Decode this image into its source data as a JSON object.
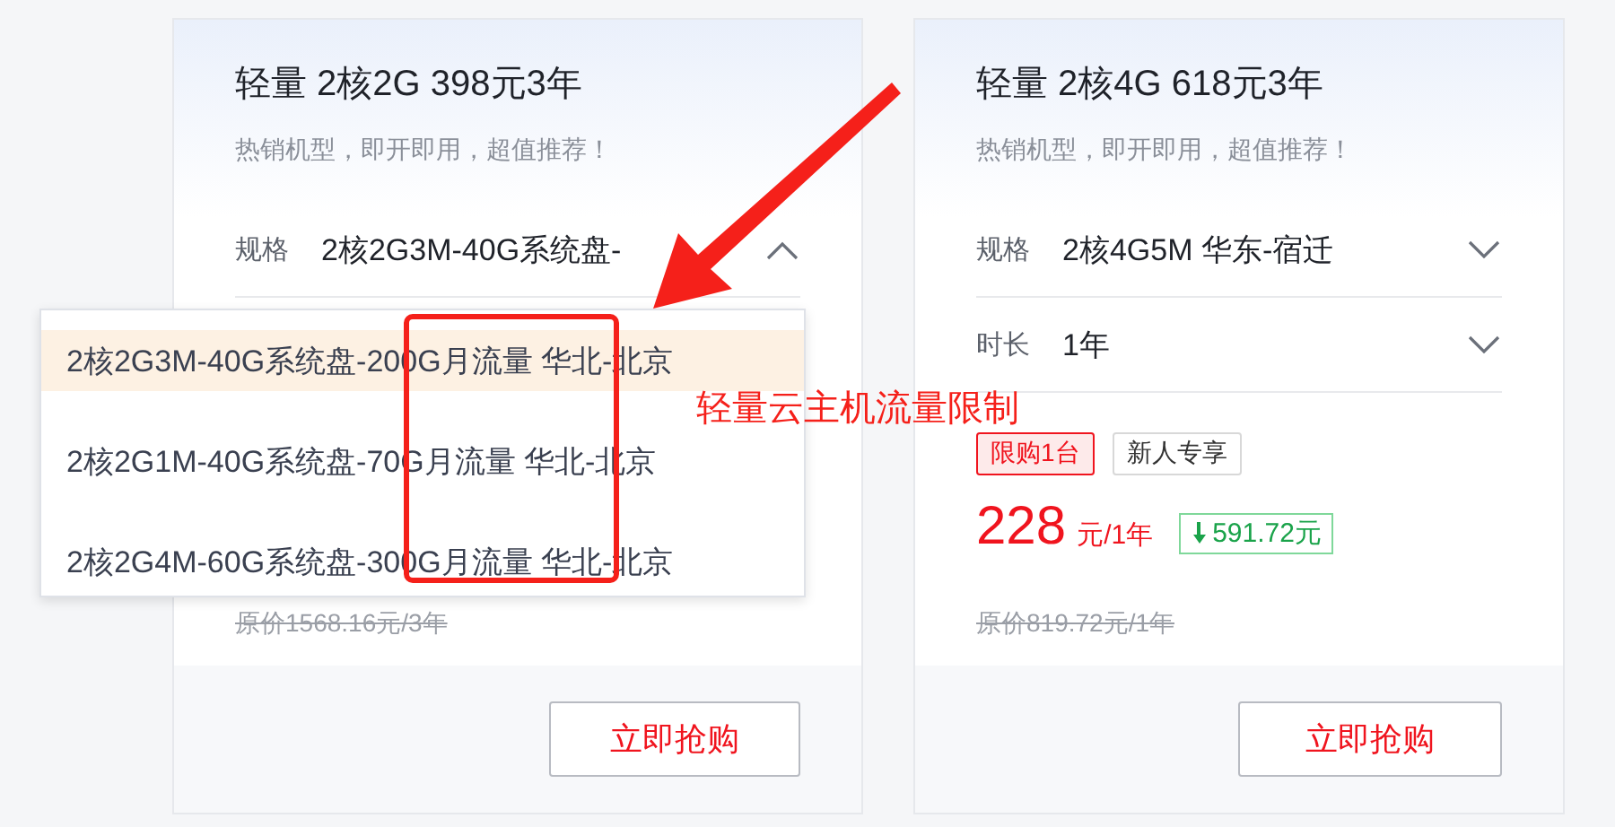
{
  "cards": [
    {
      "title": "轻量 2核2G 398元3年",
      "subtitle": "热销机型，即开即用，超值推荐！",
      "fields": [
        {
          "label": "规格",
          "value": "2核2G3M-40G系统盘-",
          "expanded": true
        }
      ],
      "original_price": "原价1568.16元/3年",
      "button": "立即抢购"
    },
    {
      "title": "轻量 2核4G 618元3年",
      "subtitle": "热销机型，即开即用，超值推荐！",
      "fields": [
        {
          "label": "规格",
          "value": "2核4G5M 华东-宿迁",
          "expanded": false
        },
        {
          "label": "时长",
          "value": "1年",
          "expanded": false
        }
      ],
      "tags": [
        {
          "text": "限购1台",
          "kind": "limit"
        },
        {
          "text": "新人专享",
          "kind": "plain"
        }
      ],
      "price": {
        "amount": "228",
        "unit": "元/1年",
        "saving": "591.72元"
      },
      "original_price": "原价819.72元/1年",
      "button": "立即抢购"
    }
  ],
  "dropdown": {
    "options": [
      {
        "text": "2核2G3M-40G系统盘-200G月流量 华北-北京",
        "selected": true
      },
      {
        "text": "2核2G1M-40G系统盘-70G月流量 华北-北京",
        "selected": false
      },
      {
        "text": "2核2G4M-60G系统盘-300G月流量 华北-北京",
        "selected": false
      }
    ]
  },
  "annotation": {
    "text": "轻量云主机流量限制"
  }
}
